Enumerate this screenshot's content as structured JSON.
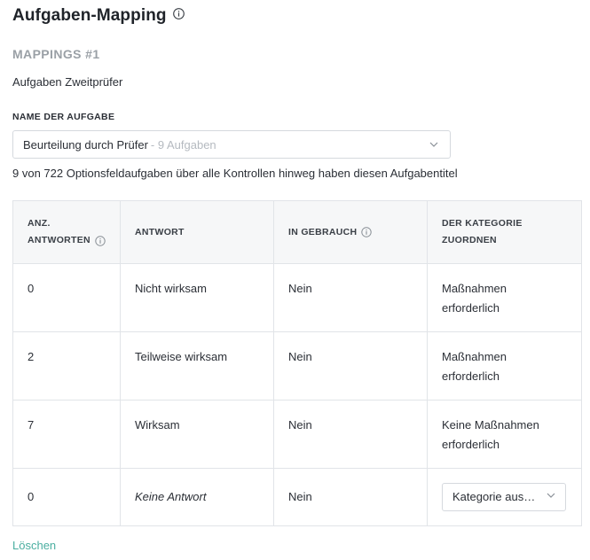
{
  "page": {
    "title": "Aufgaben-Mapping",
    "title_info_icon": "info-circle-icon"
  },
  "mapping": {
    "heading": "MAPPINGS #1",
    "subtitle": "Aufgaben Zweitprüfer",
    "field_label": "NAME DER AUFGABE",
    "selected_task": "Beurteilung durch Prüfer",
    "selected_task_hint": "- 9 Aufgaben",
    "helper_text": "9 von 722 Optionsfeldaufgaben über alle Kontrollen hinweg haben diesen Aufgabentitel"
  },
  "table": {
    "headers": {
      "count_line1": "ANZ.",
      "count_line2": "ANTWORTEN",
      "answer": "ANTWORT",
      "in_use": "IN GEBRAUCH",
      "category_line1": "DER KATEGORIE",
      "category_line2": "ZUORDNEN"
    },
    "rows": [
      {
        "count": "0",
        "answer": "Nicht wirksam",
        "in_use": "Nein",
        "category_line1": "Maßnahmen",
        "category_line2": "erforderlich"
      },
      {
        "count": "2",
        "answer": "Teilweise wirksam",
        "in_use": "Nein",
        "category_line1": "Maßnahmen",
        "category_line2": "erforderlich"
      },
      {
        "count": "7",
        "answer": "Wirksam",
        "in_use": "Nein",
        "category_line1": "Keine Maßnahmen",
        "category_line2": "erforderlich"
      },
      {
        "count": "0",
        "answer": "Keine Antwort",
        "in_use": "Nein",
        "category_select": "Kategorie aus…"
      }
    ]
  },
  "actions": {
    "delete_label": "Löschen"
  },
  "colors": {
    "link": "#4aaea0",
    "muted_heading": "#9aa0a6",
    "header_bg": "#f6f7f8",
    "border": "#e1e4e8"
  }
}
